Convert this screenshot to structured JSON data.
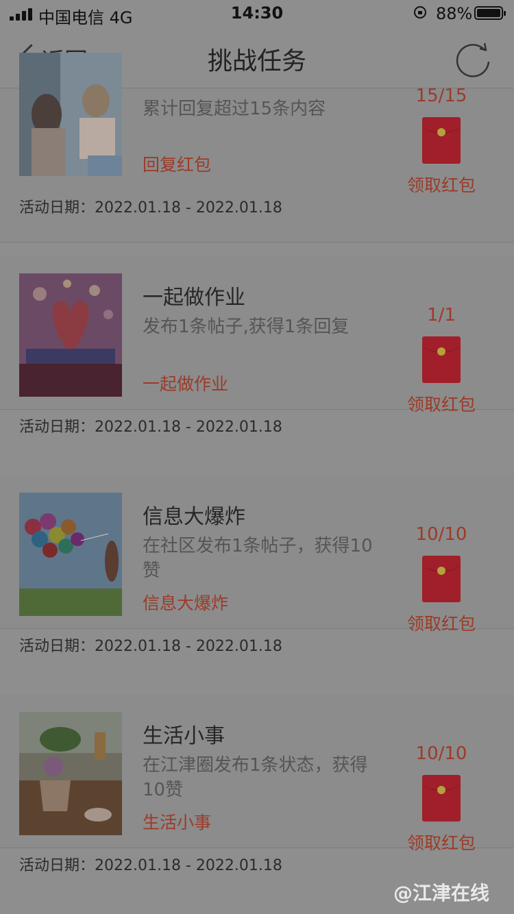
{
  "status": {
    "carrier": "中国电信  4G",
    "time": "14:30",
    "battery": "88%"
  },
  "nav": {
    "back_label": "返回",
    "title": "挑战任务"
  },
  "tasks": [
    {
      "name": "",
      "desc": "累计回复超过15条内容",
      "tag": "回复红包",
      "progress": "15/15",
      "claim": "领取红包",
      "date": "活动日期：2022.01.18 - 2022.01.18"
    },
    {
      "name": "一起做作业",
      "desc": "发布1条帖子,获得1条回复",
      "tag": "一起做作业",
      "progress": "1/1",
      "claim": "领取红包",
      "date": "活动日期：2022.01.18 - 2022.01.18"
    },
    {
      "name": "信息大爆炸",
      "desc": "在社区发布1条帖子，获得10赞",
      "tag": "信息大爆炸",
      "progress": "10/10",
      "claim": "领取红包",
      "date": "活动日期：2022.01.18 - 2022.01.18"
    },
    {
      "name": "生活小事",
      "desc": "在江津圈发布1条状态，获得10赞",
      "tag": "生活小事",
      "progress": "10/10",
      "claim": "领取红包",
      "date": "活动日期：2022.01.18 - 2022.01.18"
    }
  ],
  "watermark": "@江津在线",
  "colors": {
    "accent": "#9b3b28",
    "envelope": "#a01f2a",
    "overlay_bg": "#8e8e8e"
  }
}
